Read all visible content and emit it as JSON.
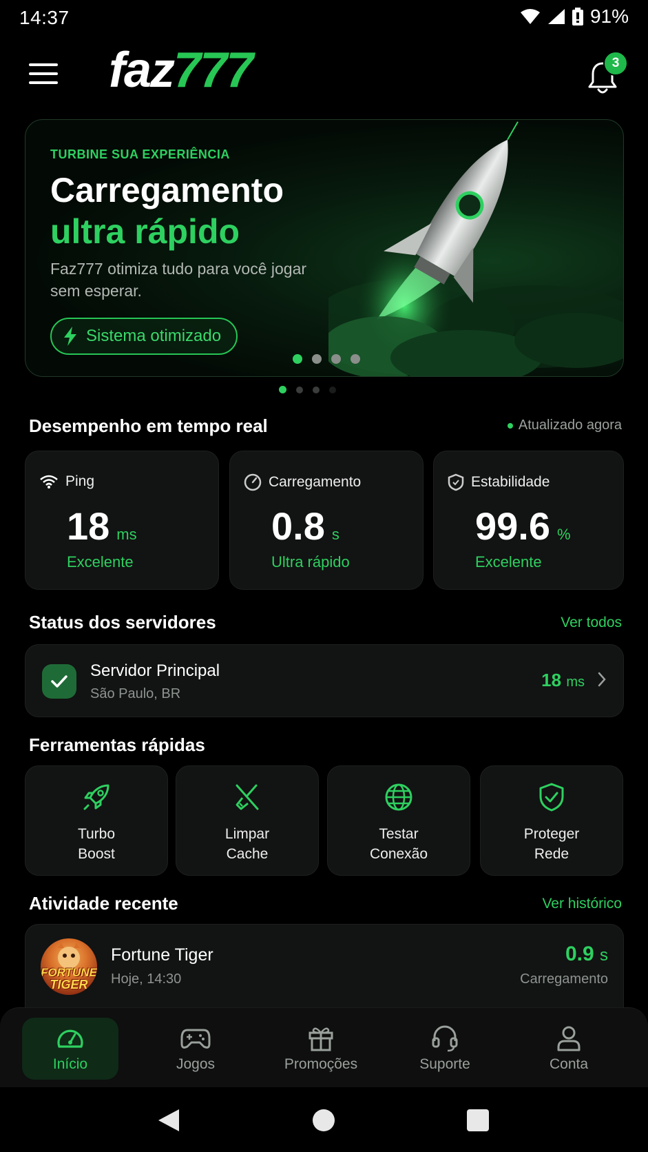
{
  "status_bar": {
    "time": "14:37",
    "battery": "91%"
  },
  "header": {
    "logo_part1": "faz",
    "logo_part2": "777",
    "notification_count": "3"
  },
  "banner": {
    "eyebrow": "TURBINE SUA EXPERIÊNCIA",
    "title_line1": "Carregamento",
    "title_line2": "ultra rápido",
    "subtitle": "Faz777 otimiza tudo para você jogar sem esperar.",
    "cta": "Sistema otimizado"
  },
  "performance": {
    "title": "Desempenho em tempo real",
    "updated": "Atualizado agora",
    "metrics": [
      {
        "label": "Ping",
        "value": "18",
        "unit": "ms",
        "note": "Excelente"
      },
      {
        "label": "Carregamento",
        "value": "0.8",
        "unit": "s",
        "note": "Ultra rápido"
      },
      {
        "label": "Estabilidade",
        "value": "99.6",
        "unit": "%",
        "note": "Excelente"
      }
    ]
  },
  "servers": {
    "title": "Status dos servidores",
    "link": "Ver todos",
    "item": {
      "name": "Servidor Principal",
      "location": "São Paulo, BR",
      "ping": "18",
      "unit": "ms"
    }
  },
  "tools": {
    "title": "Ferramentas rápidas",
    "items": [
      {
        "line1": "Turbo",
        "line2": "Boost",
        "icon": "rocket-icon"
      },
      {
        "line1": "Limpar",
        "line2": "Cache",
        "icon": "broom-icon"
      },
      {
        "line1": "Testar",
        "line2": "Conexão",
        "icon": "globe-icon"
      },
      {
        "line1": "Proteger",
        "line2": "Rede",
        "icon": "shield-check-icon"
      }
    ]
  },
  "activity": {
    "title": "Atividade recente",
    "link": "Ver histórico",
    "item": {
      "name": "Fortune Tiger",
      "time": "Hoje, 14:30",
      "value": "0.9",
      "unit": "s",
      "label": "Carregamento",
      "logo_line1": "FORTUNE",
      "logo_line2": "TIGER"
    }
  },
  "nav": {
    "items": [
      {
        "label": "Início",
        "icon": "speedometer-icon"
      },
      {
        "label": "Jogos",
        "icon": "gamepad-icon"
      },
      {
        "label": "Promoções",
        "icon": "gift-icon"
      },
      {
        "label": "Suporte",
        "icon": "headset-icon"
      },
      {
        "label": "Conta",
        "icon": "user-icon"
      }
    ]
  },
  "colors": {
    "accent": "#2ed060",
    "background": "#000000",
    "card": "#121313"
  }
}
